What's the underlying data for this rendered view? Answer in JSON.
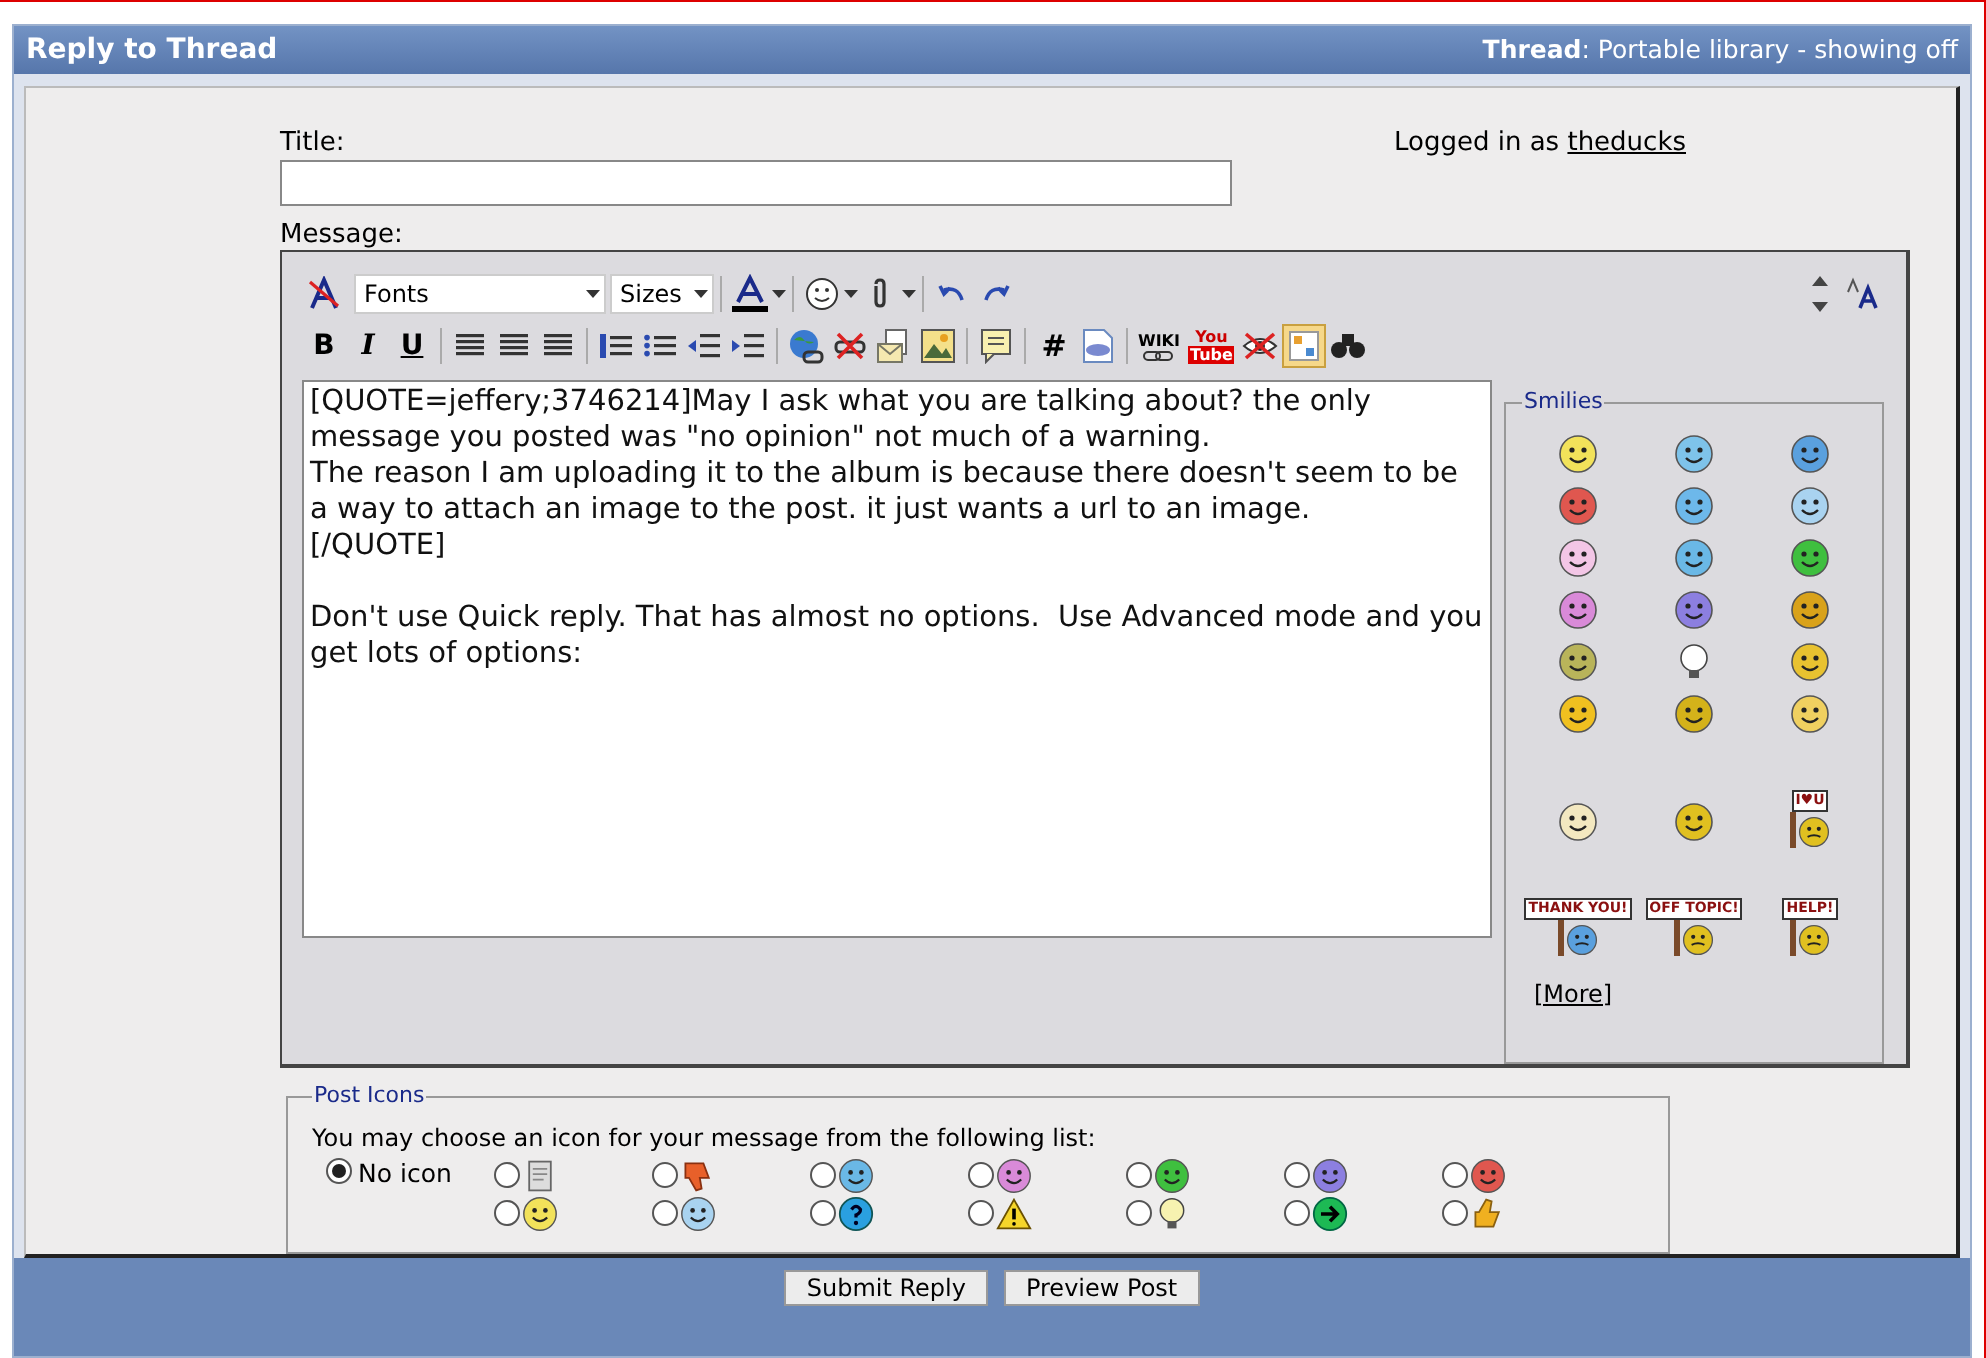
{
  "header": {
    "title": "Reply to Thread",
    "thread": "**Thread**: Portable library - showing off"
  },
  "title_field": {
    "label": "Title:"
  },
  "login": {
    "prefix": "Logged in as",
    "user": "theducks"
  },
  "message": {
    "label": "Message:",
    "text": "[QUOTE=jeffery;3746214]May I ask what you are talking about? the only message you posted was \"no opinion\" not much of a warning.\nThe reason I am uploading it to the album is because there doesn't seem to be a way to attach an image to the post. it just wants a url to an image.\n[/QUOTE]\n\nDon't use Quick reply. That has almost no options.  Use Advanced mode and you get lots of options:"
  },
  "toolbar": {
    "font_select": "Fonts",
    "size_select": "Sizes",
    "bold": "B",
    "italic": "I",
    "underline": "U",
    "code": "#",
    "wiki": "WIKI",
    "youtube_top": "You",
    "youtube_bottom": "Tube"
  },
  "smilies": {
    "legend": "Smilies",
    "more": "[More]",
    "items": [
      {
        "kind": "face",
        "color": "#f2e25a"
      },
      {
        "kind": "face",
        "color": "#7ec3ea"
      },
      {
        "kind": "face",
        "color": "#5aa0de"
      },
      {
        "kind": "face",
        "color": "#e0574f"
      },
      {
        "kind": "face",
        "color": "#6db8ea"
      },
      {
        "kind": "face",
        "color": "#a9d3f0"
      },
      {
        "kind": "face",
        "color": "#f3c6e6"
      },
      {
        "kind": "face",
        "color": "#6ab8e6"
      },
      {
        "kind": "face",
        "color": "#3fbf3f"
      },
      {
        "kind": "face",
        "color": "#d98ad8"
      },
      {
        "kind": "face",
        "color": "#8c7fe0"
      },
      {
        "kind": "face",
        "color": "#d9a21a"
      },
      {
        "kind": "face",
        "color": "#b9b45a"
      },
      {
        "kind": "bulb",
        "color": "#ffffff"
      },
      {
        "kind": "face",
        "color": "#e8c230"
      },
      {
        "kind": "face",
        "color": "#f0c020"
      },
      {
        "kind": "face",
        "color": "#d4b21a"
      },
      {
        "kind": "face",
        "color": "#f0d060"
      },
      {
        "kind": "face",
        "color": "#f3e8c0"
      },
      {
        "kind": "face",
        "color": "#e0c020"
      },
      {
        "kind": "sign",
        "color": "#e0c020",
        "text": "I♥U"
      },
      {
        "kind": "sign",
        "color": "#5aa0de",
        "text": "THANK YOU!"
      },
      {
        "kind": "sign",
        "color": "#e0c020",
        "text": "OFF TOPIC!"
      },
      {
        "kind": "sign",
        "color": "#e0c020",
        "text": "HELP!"
      }
    ]
  },
  "post_icons": {
    "legend": "Post Icons",
    "intro": "You may choose an icon for your message from the following list:",
    "none": {
      "label": "No icon",
      "selected": true
    },
    "items": [
      {
        "kind": "doc",
        "color": "#dddddd",
        "selected": false
      },
      {
        "kind": "thumbdown",
        "color": "#e8602a",
        "selected": false
      },
      {
        "kind": "face",
        "color": "#6ab8e6",
        "selected": false
      },
      {
        "kind": "face",
        "color": "#d98ad8",
        "selected": false
      },
      {
        "kind": "face",
        "color": "#3fbf3f",
        "selected": false
      },
      {
        "kind": "face",
        "color": "#8c7fe0",
        "selected": false
      },
      {
        "kind": "face",
        "color": "#e0574f",
        "selected": false
      },
      {
        "kind": "face",
        "color": "#f2e25a",
        "selected": false
      },
      {
        "kind": "face",
        "color": "#a9d3f0",
        "selected": false
      },
      {
        "kind": "question",
        "color": "#2aa0e0",
        "selected": false
      },
      {
        "kind": "warning",
        "color": "#f5d52a",
        "selected": false
      },
      {
        "kind": "bulb",
        "color": "#f7f2b0",
        "selected": false
      },
      {
        "kind": "arrow",
        "color": "#1db954",
        "selected": false
      },
      {
        "kind": "thumbup",
        "color": "#f0b020",
        "selected": false
      }
    ]
  },
  "buttons": [
    "Submit Reply",
    "Preview Post"
  ]
}
